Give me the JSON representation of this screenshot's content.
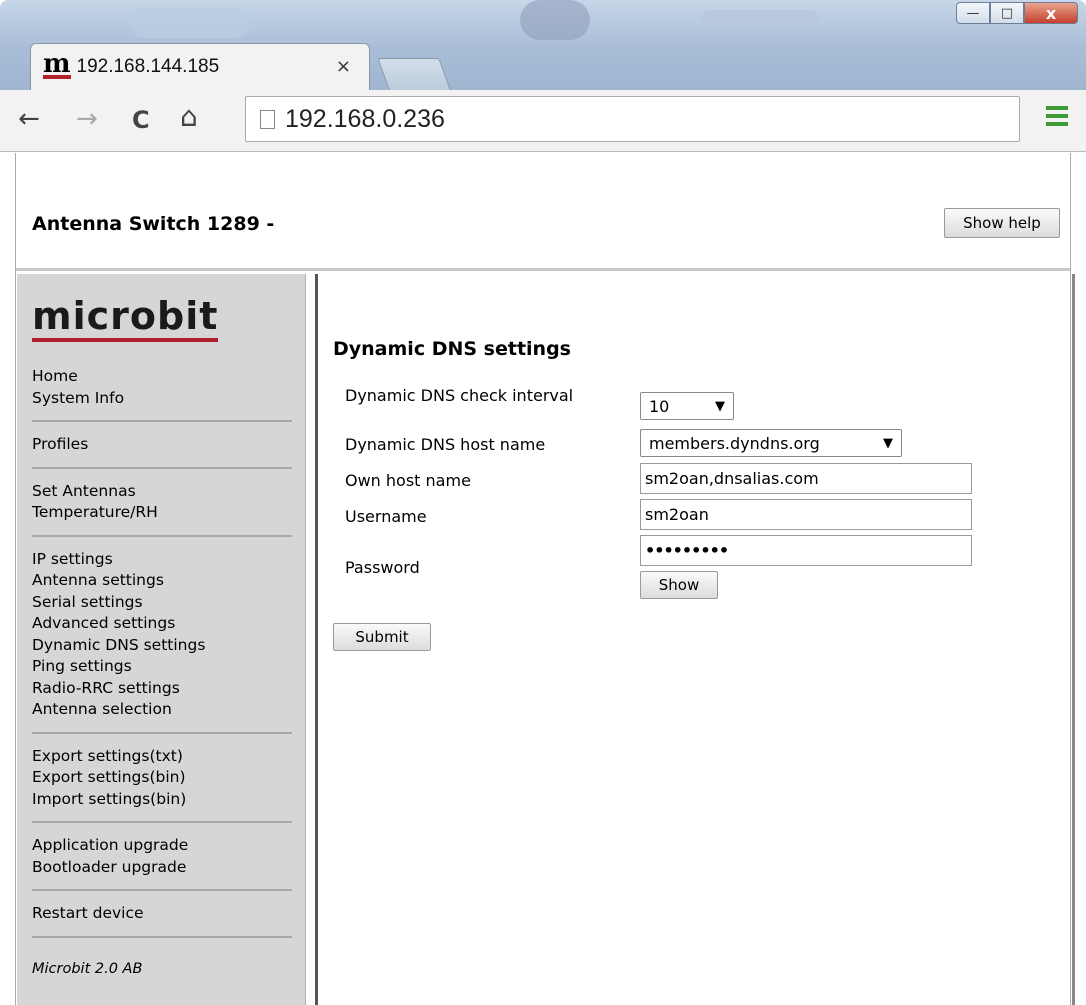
{
  "browser": {
    "tab_title": "192.168.144.185",
    "tab_favicon": "m",
    "tab_close": "×",
    "url": "192.168.0.236",
    "controls": {
      "minimize": "—",
      "maximize": "□",
      "close": "x"
    },
    "nav": {
      "back": "←",
      "forward": "→",
      "reload": "C",
      "home": "⌂"
    }
  },
  "header": {
    "title": "Antenna Switch 1289 -",
    "help_button": "Show help"
  },
  "sidebar": {
    "logo": "microbit",
    "groups": [
      [
        "Home",
        "System Info"
      ],
      [
        "Profiles"
      ],
      [
        "Set Antennas",
        "Temperature/RH"
      ],
      [
        "IP settings",
        "Antenna settings",
        "Serial settings",
        "Advanced settings",
        "Dynamic DNS settings",
        "Ping settings",
        "Radio-RRC settings",
        "Antenna selection"
      ],
      [
        "Export settings(txt)",
        "Export settings(bin)",
        "Import settings(bin)"
      ],
      [
        "Application upgrade",
        "Bootloader upgrade"
      ],
      [
        "Restart device"
      ]
    ],
    "footer": "Microbit 2.0 AB"
  },
  "form": {
    "title": "Dynamic DNS settings",
    "interval_label": "Dynamic DNS check interval",
    "interval_value": "10",
    "host_label": "Dynamic DNS host name",
    "host_value": "members.dyndns.org",
    "own_host_label": "Own host name",
    "own_host_value": "sm2oan,dnsalias.com",
    "username_label": "Username",
    "username_value": "sm2oan",
    "password_label": "Password",
    "password_value": "•••••••••",
    "show_button": "Show",
    "submit_button": "Submit"
  },
  "colors": {
    "brand_red": "#b21f2e",
    "sidebar_bg": "#d6d6d6",
    "menu_green": "#3d9b35"
  }
}
